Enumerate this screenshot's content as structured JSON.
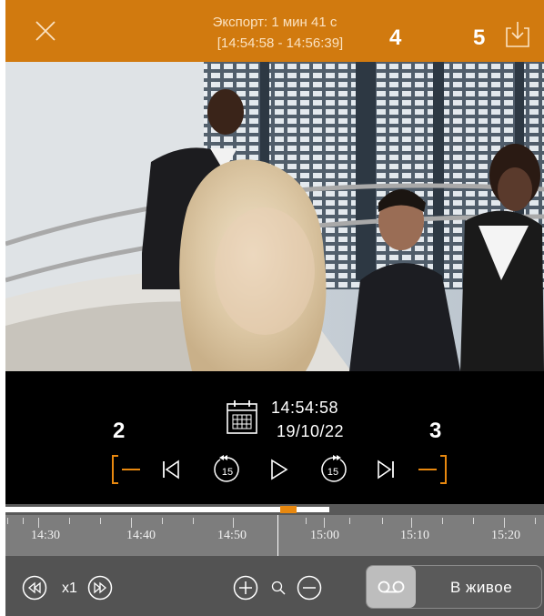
{
  "export_bar": {
    "duration_text": "Экспорт: 1 мин 41 с",
    "range_text": "[14:54:58 - 14:56:39]",
    "callout_4": "4",
    "callout_5": "5",
    "background_color": "#d17a0f"
  },
  "player": {
    "time": "14:54:58",
    "date": "19/10/22",
    "callout_2": "2",
    "callout_3": "3",
    "skip_back_seconds": "15",
    "skip_forward_seconds": "15",
    "accent_color": "#e8880f"
  },
  "timeline": {
    "labels": [
      "14:30",
      "14:40",
      "14:50",
      "15:00",
      "15:10",
      "15:20"
    ]
  },
  "bottom_bar": {
    "speed": "x1",
    "live_label": "В живое"
  }
}
